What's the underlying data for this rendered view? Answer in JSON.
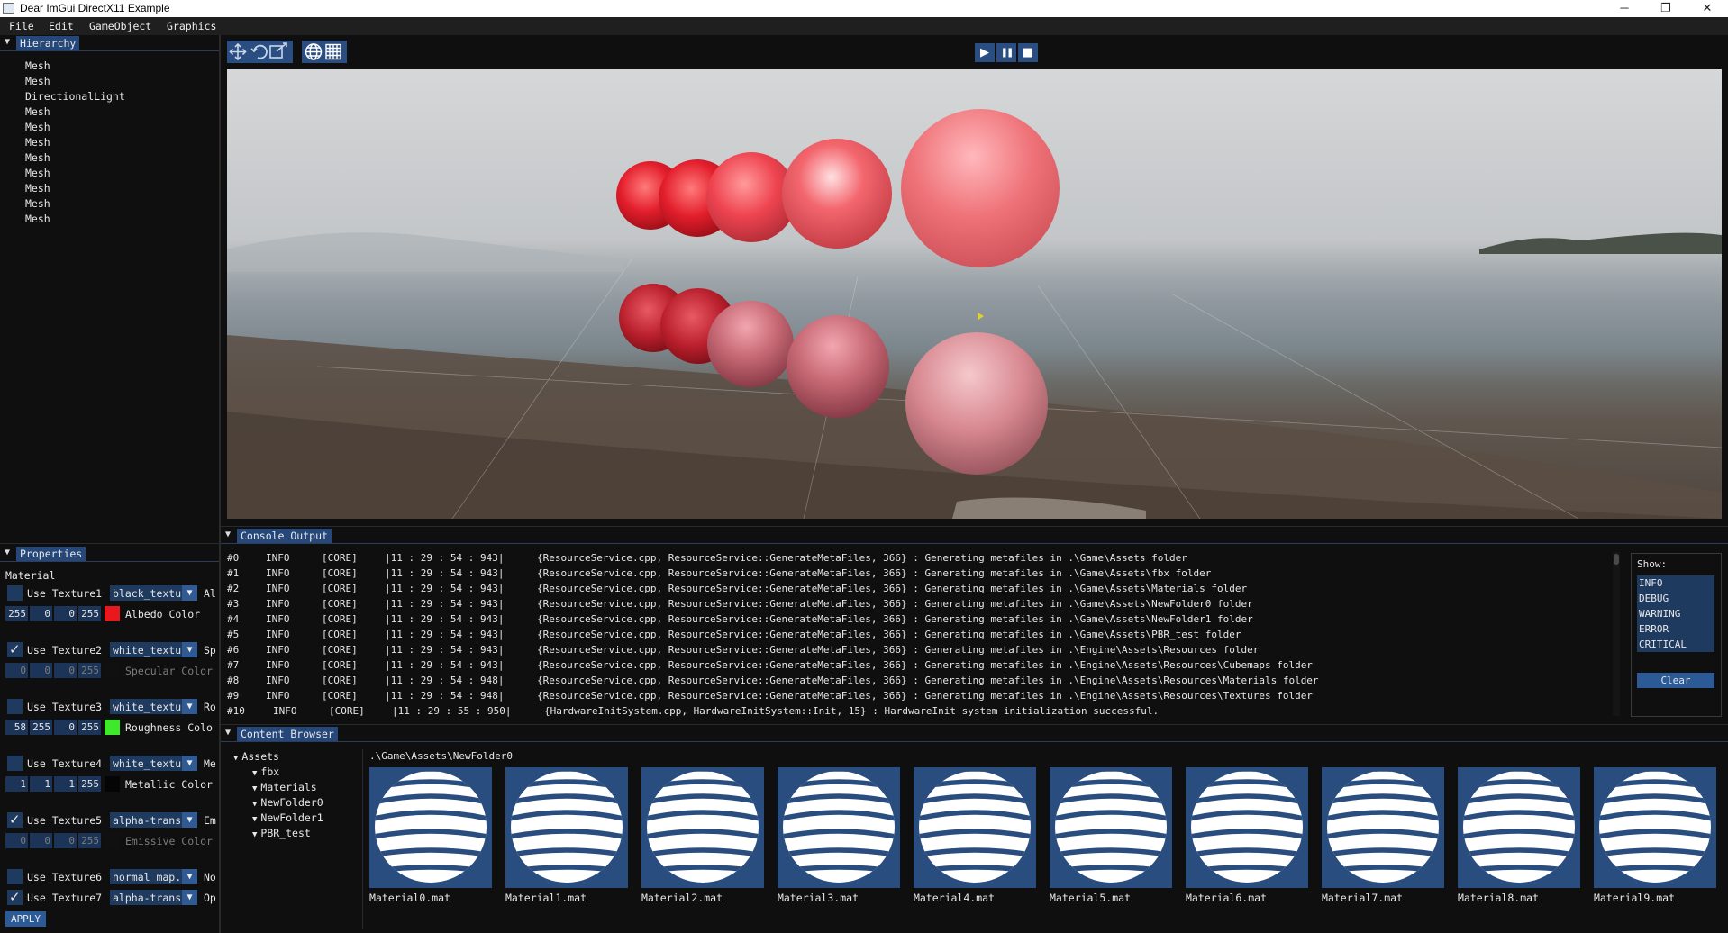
{
  "window": {
    "title": "Dear ImGui DirectX11 Example",
    "controls": [
      "─",
      "❐",
      "✕"
    ]
  },
  "menu": [
    "File",
    "Edit",
    "GameObject",
    "Graphics"
  ],
  "hierarchy": {
    "title": "Hierarchy",
    "items": [
      "Mesh",
      "Mesh",
      "DirectionalLight",
      "Mesh",
      "Mesh",
      "Mesh",
      "Mesh",
      "Mesh",
      "Mesh",
      "Mesh",
      "Mesh"
    ]
  },
  "properties": {
    "title": "Properties",
    "section": "Material",
    "rows": [
      {
        "checked": false,
        "label": "Use Texture1",
        "texture": "black_textu",
        "short": "Al",
        "values": [
          "255",
          "0",
          "0",
          "255"
        ],
        "color": "#e8181c",
        "color_label": "Albedo Color",
        "dim": false
      },
      {
        "checked": true,
        "label": "Use Texture2",
        "texture": "white_textu",
        "short": "Sp",
        "values": [
          "0",
          "0",
          "0",
          "255"
        ],
        "color": "#101010",
        "color_label": "Specular Color",
        "dim": true
      },
      {
        "checked": false,
        "label": "Use Texture3",
        "texture": "white_textu",
        "short": "Ro",
        "values": [
          "58",
          "255",
          "0",
          "255"
        ],
        "color": "#3ee82a",
        "color_label": "Roughness Colo",
        "dim": false
      },
      {
        "checked": false,
        "label": "Use Texture4",
        "texture": "white_textu",
        "short": "Me",
        "values": [
          "1",
          "1",
          "1",
          "255"
        ],
        "color": "#050505",
        "color_label": "Metallic Color",
        "dim": false
      },
      {
        "checked": true,
        "label": "Use Texture5",
        "texture": "alpha-trans",
        "short": "Em",
        "values": [
          "0",
          "0",
          "0",
          "255"
        ],
        "color": "#101010",
        "color_label": "Emissive Color",
        "dim": true
      },
      {
        "checked": false,
        "label": "Use Texture6",
        "texture": "normal_map.",
        "short": "No",
        "dim": false
      },
      {
        "checked": true,
        "label": "Use Texture7",
        "texture": "alpha-trans",
        "short": "Op",
        "dim": false
      }
    ],
    "apply_label": "APPLY"
  },
  "viewport": {
    "toolbar_icons": [
      "move-icon",
      "rotate-icon",
      "scale-icon",
      "globe-icon",
      "grid-icon"
    ],
    "play_controls": [
      "▶",
      "❚❚",
      "■"
    ]
  },
  "console": {
    "title": "Console Output",
    "lines": [
      {
        "id": "#0",
        "level": "INFO",
        "tag": "[CORE]",
        "time": "|11 : 29 : 54 : 943|",
        "msg": "{ResourceService.cpp, ResourceService::GenerateMetaFiles, 366} : Generating metafiles in .\\Game\\Assets folder"
      },
      {
        "id": "#1",
        "level": "INFO",
        "tag": "[CORE]",
        "time": "|11 : 29 : 54 : 943|",
        "msg": "{ResourceService.cpp, ResourceService::GenerateMetaFiles, 366} : Generating metafiles in .\\Game\\Assets\\fbx folder"
      },
      {
        "id": "#2",
        "level": "INFO",
        "tag": "[CORE]",
        "time": "|11 : 29 : 54 : 943|",
        "msg": "{ResourceService.cpp, ResourceService::GenerateMetaFiles, 366} : Generating metafiles in .\\Game\\Assets\\Materials folder"
      },
      {
        "id": "#3",
        "level": "INFO",
        "tag": "[CORE]",
        "time": "|11 : 29 : 54 : 943|",
        "msg": "{ResourceService.cpp, ResourceService::GenerateMetaFiles, 366} : Generating metafiles in .\\Game\\Assets\\NewFolder0 folder"
      },
      {
        "id": "#4",
        "level": "INFO",
        "tag": "[CORE]",
        "time": "|11 : 29 : 54 : 943|",
        "msg": "{ResourceService.cpp, ResourceService::GenerateMetaFiles, 366} : Generating metafiles in .\\Game\\Assets\\NewFolder1 folder"
      },
      {
        "id": "#5",
        "level": "INFO",
        "tag": "[CORE]",
        "time": "|11 : 29 : 54 : 943|",
        "msg": "{ResourceService.cpp, ResourceService::GenerateMetaFiles, 366} : Generating metafiles in .\\Game\\Assets\\PBR_test folder"
      },
      {
        "id": "#6",
        "level": "INFO",
        "tag": "[CORE]",
        "time": "|11 : 29 : 54 : 943|",
        "msg": "{ResourceService.cpp, ResourceService::GenerateMetaFiles, 366} : Generating metafiles in .\\Engine\\Assets\\Resources folder"
      },
      {
        "id": "#7",
        "level": "INFO",
        "tag": "[CORE]",
        "time": "|11 : 29 : 54 : 943|",
        "msg": "{ResourceService.cpp, ResourceService::GenerateMetaFiles, 366} : Generating metafiles in .\\Engine\\Assets\\Resources\\Cubemaps folder"
      },
      {
        "id": "#8",
        "level": "INFO",
        "tag": "[CORE]",
        "time": "|11 : 29 : 54 : 948|",
        "msg": "{ResourceService.cpp, ResourceService::GenerateMetaFiles, 366} : Generating metafiles in .\\Engine\\Assets\\Resources\\Materials folder"
      },
      {
        "id": "#9",
        "level": "INFO",
        "tag": "[CORE]",
        "time": "|11 : 29 : 54 : 948|",
        "msg": "{ResourceService.cpp, ResourceService::GenerateMetaFiles, 366} : Generating metafiles in .\\Engine\\Assets\\Resources\\Textures folder"
      },
      {
        "id": "#10",
        "level": "INFO",
        "tag": "[CORE]",
        "time": "|11 : 29 : 55 : 950|",
        "msg": "{HardwareInitSystem.cpp, HardwareInitSystem::Init, 15} : HardwareInit system initialization successful."
      }
    ],
    "show_label": "Show:",
    "levels": [
      "INFO",
      "DEBUG",
      "WARNING",
      "ERROR",
      "CRITICAL"
    ],
    "clear_label": "Clear"
  },
  "content_browser": {
    "title": "Content Browser",
    "tree": [
      {
        "label": "Assets",
        "depth": 0
      },
      {
        "label": "fbx",
        "depth": 1
      },
      {
        "label": "Materials",
        "depth": 1
      },
      {
        "label": "NewFolder0",
        "depth": 1
      },
      {
        "label": "NewFolder1",
        "depth": 1
      },
      {
        "label": "PBR_test",
        "depth": 1
      }
    ],
    "path": ".\\Game\\Assets\\NewFolder0",
    "assets": [
      "Material0.mat",
      "Material1.mat",
      "Material2.mat",
      "Material3.mat",
      "Material4.mat",
      "Material5.mat",
      "Material6.mat",
      "Material7.mat",
      "Material8.mat",
      "Material9.mat"
    ]
  }
}
